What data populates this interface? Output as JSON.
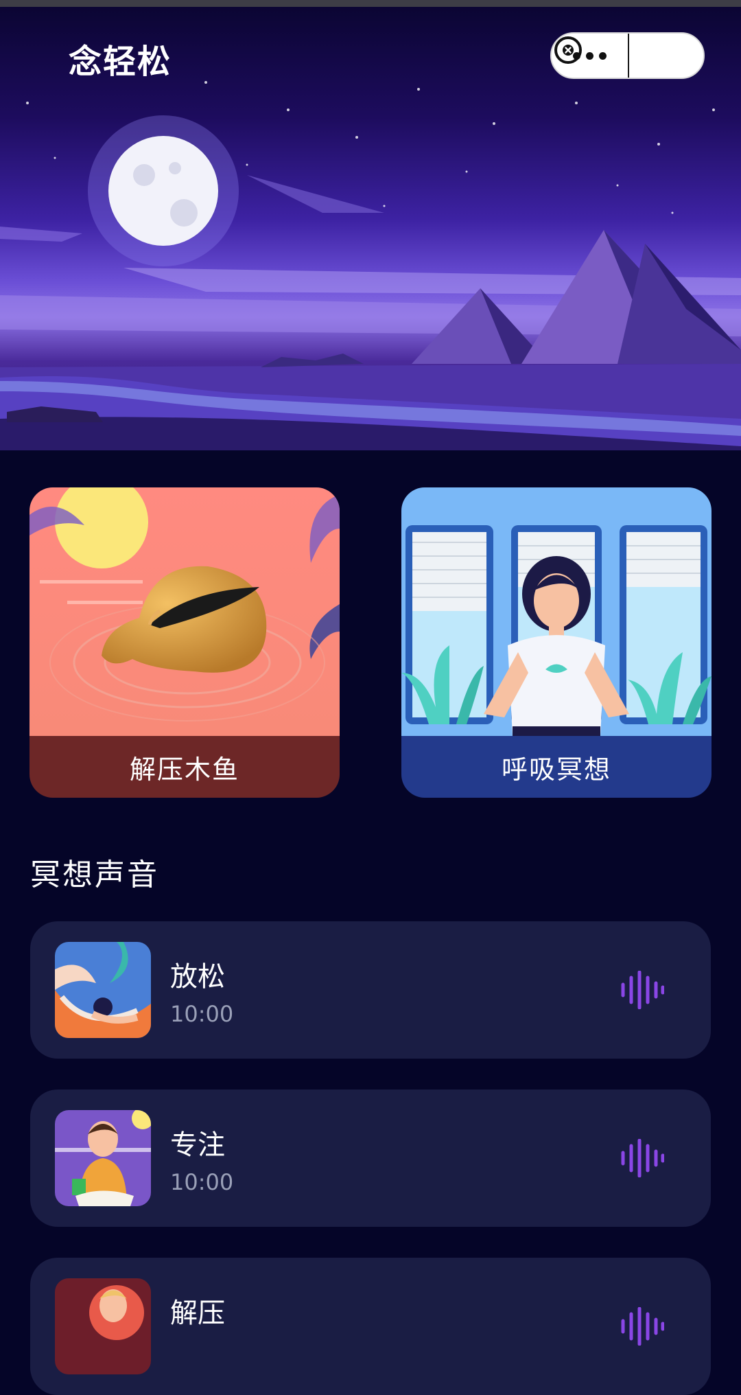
{
  "header": {
    "title": "念轻松"
  },
  "capsule": {
    "more_icon": "more-dots-icon",
    "close_icon": "close-circle-icon"
  },
  "cards": [
    {
      "label": "解压木鱼",
      "color": "#6d2727"
    },
    {
      "label": "呼吸冥想",
      "color": "#233a8c"
    }
  ],
  "section": {
    "title": "冥想声音"
  },
  "sounds": [
    {
      "name": "放松",
      "duration": "10:00"
    },
    {
      "name": "专注",
      "duration": "10:00"
    },
    {
      "name": "解压",
      "duration": ""
    }
  ],
  "colors": {
    "background": "#050528",
    "card_item": "#1a1d44",
    "wave_accent": "#8a46e6"
  }
}
